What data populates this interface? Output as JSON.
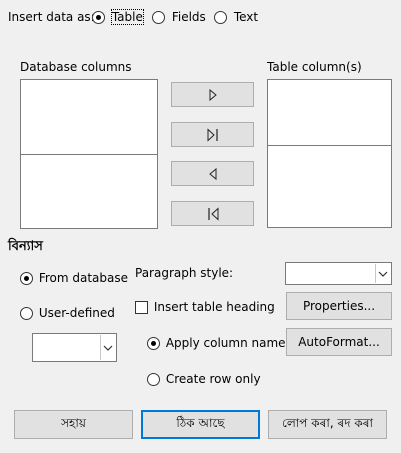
{
  "insert_as": {
    "label": "Insert data as:",
    "options": [
      {
        "label": "Table",
        "selected": true
      },
      {
        "label": "Fields",
        "selected": false
      },
      {
        "label": "Text",
        "selected": false
      }
    ]
  },
  "database_columns": {
    "label": "Database columns"
  },
  "table_columns": {
    "label": "Table column(s)"
  },
  "move_buttons": [
    "move-right-icon",
    "move-all-right-icon",
    "move-left-icon",
    "move-all-left-icon"
  ],
  "format": {
    "heading": "বিন্যাস",
    "from_database": {
      "label": "From database",
      "selected": true
    },
    "user_defined": {
      "label": "User-defined",
      "selected": false
    },
    "paragraph_style": {
      "label": "Paragraph style:",
      "value": ""
    },
    "insert_table_heading": {
      "label": "Insert table heading",
      "checked": false
    },
    "apply_column_name": {
      "label": "Apply column name",
      "selected": true
    },
    "create_row_only": {
      "label": "Create row only",
      "selected": false
    },
    "properties_button": "Properties...",
    "autoformat_button": "AutoFormat..."
  },
  "footer": {
    "help": "সহায়",
    "ok": "ঠিক আছে",
    "cancel": "লোপ কৰা, ৰদ কৰা"
  }
}
